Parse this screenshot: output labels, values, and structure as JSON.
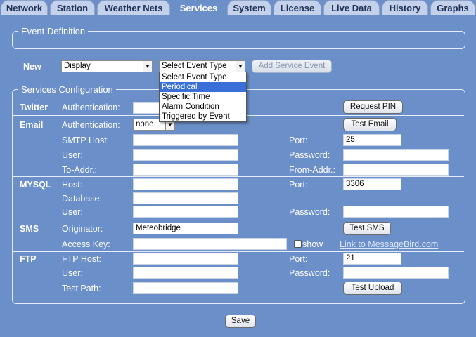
{
  "tabs": [
    "Network",
    "Station",
    "Weather Nets",
    "Services",
    "System",
    "License",
    "Live Data",
    "History",
    "Graphs"
  ],
  "active_tab": "Services",
  "event_definition": {
    "legend": "Event Definition"
  },
  "new_row": {
    "label": "New",
    "display_select": "Display",
    "event_type_select": "Select Event Type",
    "add_button": "Add Service Event",
    "dropdown_options": [
      "Select Event Type",
      "Periodical",
      "Specific Time",
      "Alarm Condition",
      "Triggered by Event"
    ],
    "dropdown_highlighted": "Periodical"
  },
  "services": {
    "legend": "Services Configuration",
    "twitter": {
      "title": "Twitter",
      "auth_label": "Authentication:",
      "auth_value": "",
      "request_pin": "Request PIN"
    },
    "email": {
      "title": "Email",
      "auth_label": "Authentication:",
      "auth_value": "none",
      "test_button": "Test Email",
      "smtp_label": "SMTP Host:",
      "smtp_value": "",
      "port_label": "Port:",
      "port_value": "25",
      "user_label": "User:",
      "user_value": "",
      "password_label": "Password:",
      "password_value": "",
      "to_label": "To-Addr.:",
      "to_value": "",
      "from_label": "From-Addr.:",
      "from_value": ""
    },
    "mysql": {
      "title": "MYSQL",
      "host_label": "Host:",
      "host_value": "",
      "port_label": "Port:",
      "port_value": "3306",
      "database_label": "Database:",
      "database_value": "",
      "user_label": "User:",
      "user_value": "",
      "password_label": "Password:",
      "password_value": ""
    },
    "sms": {
      "title": "SMS",
      "originator_label": "Originator:",
      "originator_value": "Meteobridge",
      "test_button": "Test SMS",
      "access_key_label": "Access Key:",
      "access_key_value": "",
      "show_label": "show",
      "link": "Link to MessageBird.com"
    },
    "ftp": {
      "title": "FTP",
      "host_label": "FTP Host:",
      "host_value": "",
      "port_label": "Port:",
      "port_value": "21",
      "user_label": "User:",
      "user_value": "",
      "password_label": "Password:",
      "password_value": "",
      "test_path_label": "Test Path:",
      "test_path_value": "",
      "test_button": "Test Upload"
    }
  },
  "save_button": "Save",
  "colors": {
    "background": "#6b8fc9",
    "tab_inactive": "#c3d2ea",
    "dropdown_highlight": "#3a6fd8"
  }
}
